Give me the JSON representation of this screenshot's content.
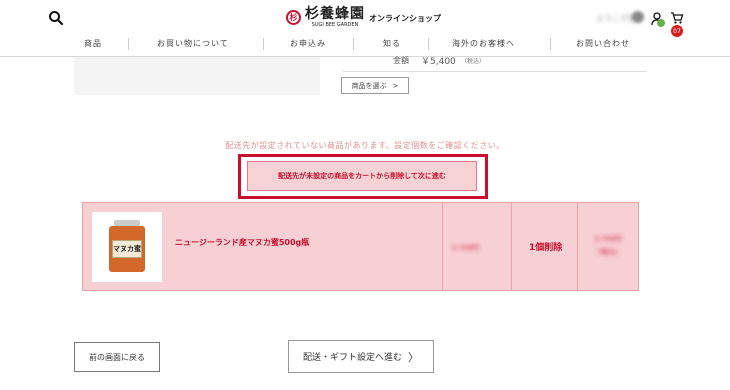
{
  "header": {
    "logo_name": "杉養蜂園",
    "logo_sub": "SUGI BEE GARDEN",
    "logo_mark": "杉",
    "shop_label": "オンラインショップ",
    "account_name": "ようこそ様",
    "cart_count": "07",
    "icons": [
      "search-icon",
      "user-icon",
      "check-icon",
      "cart-icon"
    ]
  },
  "nav": [
    "商品",
    "お買い物について",
    "お申込み",
    "知る",
    "海外のお客様へ",
    "お問い合わせ"
  ],
  "order_block": {
    "price_label": "金額",
    "price_value": "￥5,400",
    "tax_note": "（税込）",
    "select_product_label": "商品を選ぶ",
    "select_chevron": ">"
  },
  "warning": {
    "text": "配送先が設定されていない商品があります。設定個数をご確認ください。",
    "button_label": "配送先が未設定の商品をカートから削除して次に進む"
  },
  "cart_item": {
    "name": "ニュージーランド産マヌカ蜜500g瓶",
    "jar_label": "マヌカ蜜",
    "unit_price": "2,700円",
    "quantity": "1個削除",
    "subtotal_line1": "2,700円",
    "subtotal_line2": "(税込)"
  },
  "footer": {
    "back_label": "前の画面に戻る",
    "next_label": "配送・ギフト設定へ進む",
    "next_chevron": "〉"
  },
  "colors": {
    "accent": "#c8102e",
    "row_bg": "#f7d0d3",
    "warning_text": "#e0908f"
  }
}
